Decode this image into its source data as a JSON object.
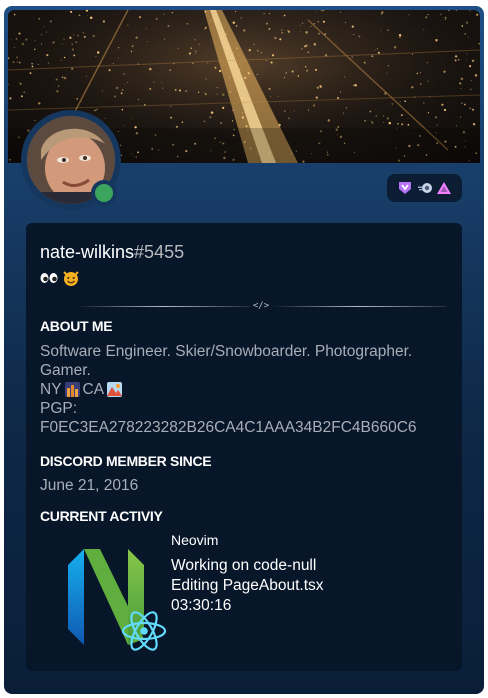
{
  "profile": {
    "username": "nate-wilkins",
    "discriminator": "#5455",
    "status": "online",
    "custom_status_emojis": [
      "eyes-emoji",
      "smiling-imp-emoji"
    ],
    "badges": [
      "nitro-badge",
      "boost-badge",
      "hypesquad-badge"
    ]
  },
  "about": {
    "title": "ABOUT ME",
    "line1": "Software Engineer. Skier/Snowboarder. Photographer. Gamer.",
    "line2a": "NY",
    "line2b": "CA",
    "line3": "PGP:",
    "line4": "F0EC3EA278223282B26CA4C1AAA34B2FC4B660C6"
  },
  "member_since": {
    "title": "DISCORD MEMBER SINCE",
    "date": "June 21, 2016"
  },
  "activity": {
    "title": "CURRENT ACTIVIY",
    "app": "Neovim",
    "details": "Working on code-null",
    "state": "Editing PageAbout.tsx",
    "elapsed": "03:30:16",
    "large_icon": "neovim-icon",
    "small_icon": "react-icon"
  },
  "colors": {
    "card_top": "#1f4f86",
    "card_bottom": "#0a1e38",
    "panel": "#08162a",
    "online": "#3ba55d",
    "muted_text": "#a8aeb8"
  },
  "divider_glyph": "</>"
}
